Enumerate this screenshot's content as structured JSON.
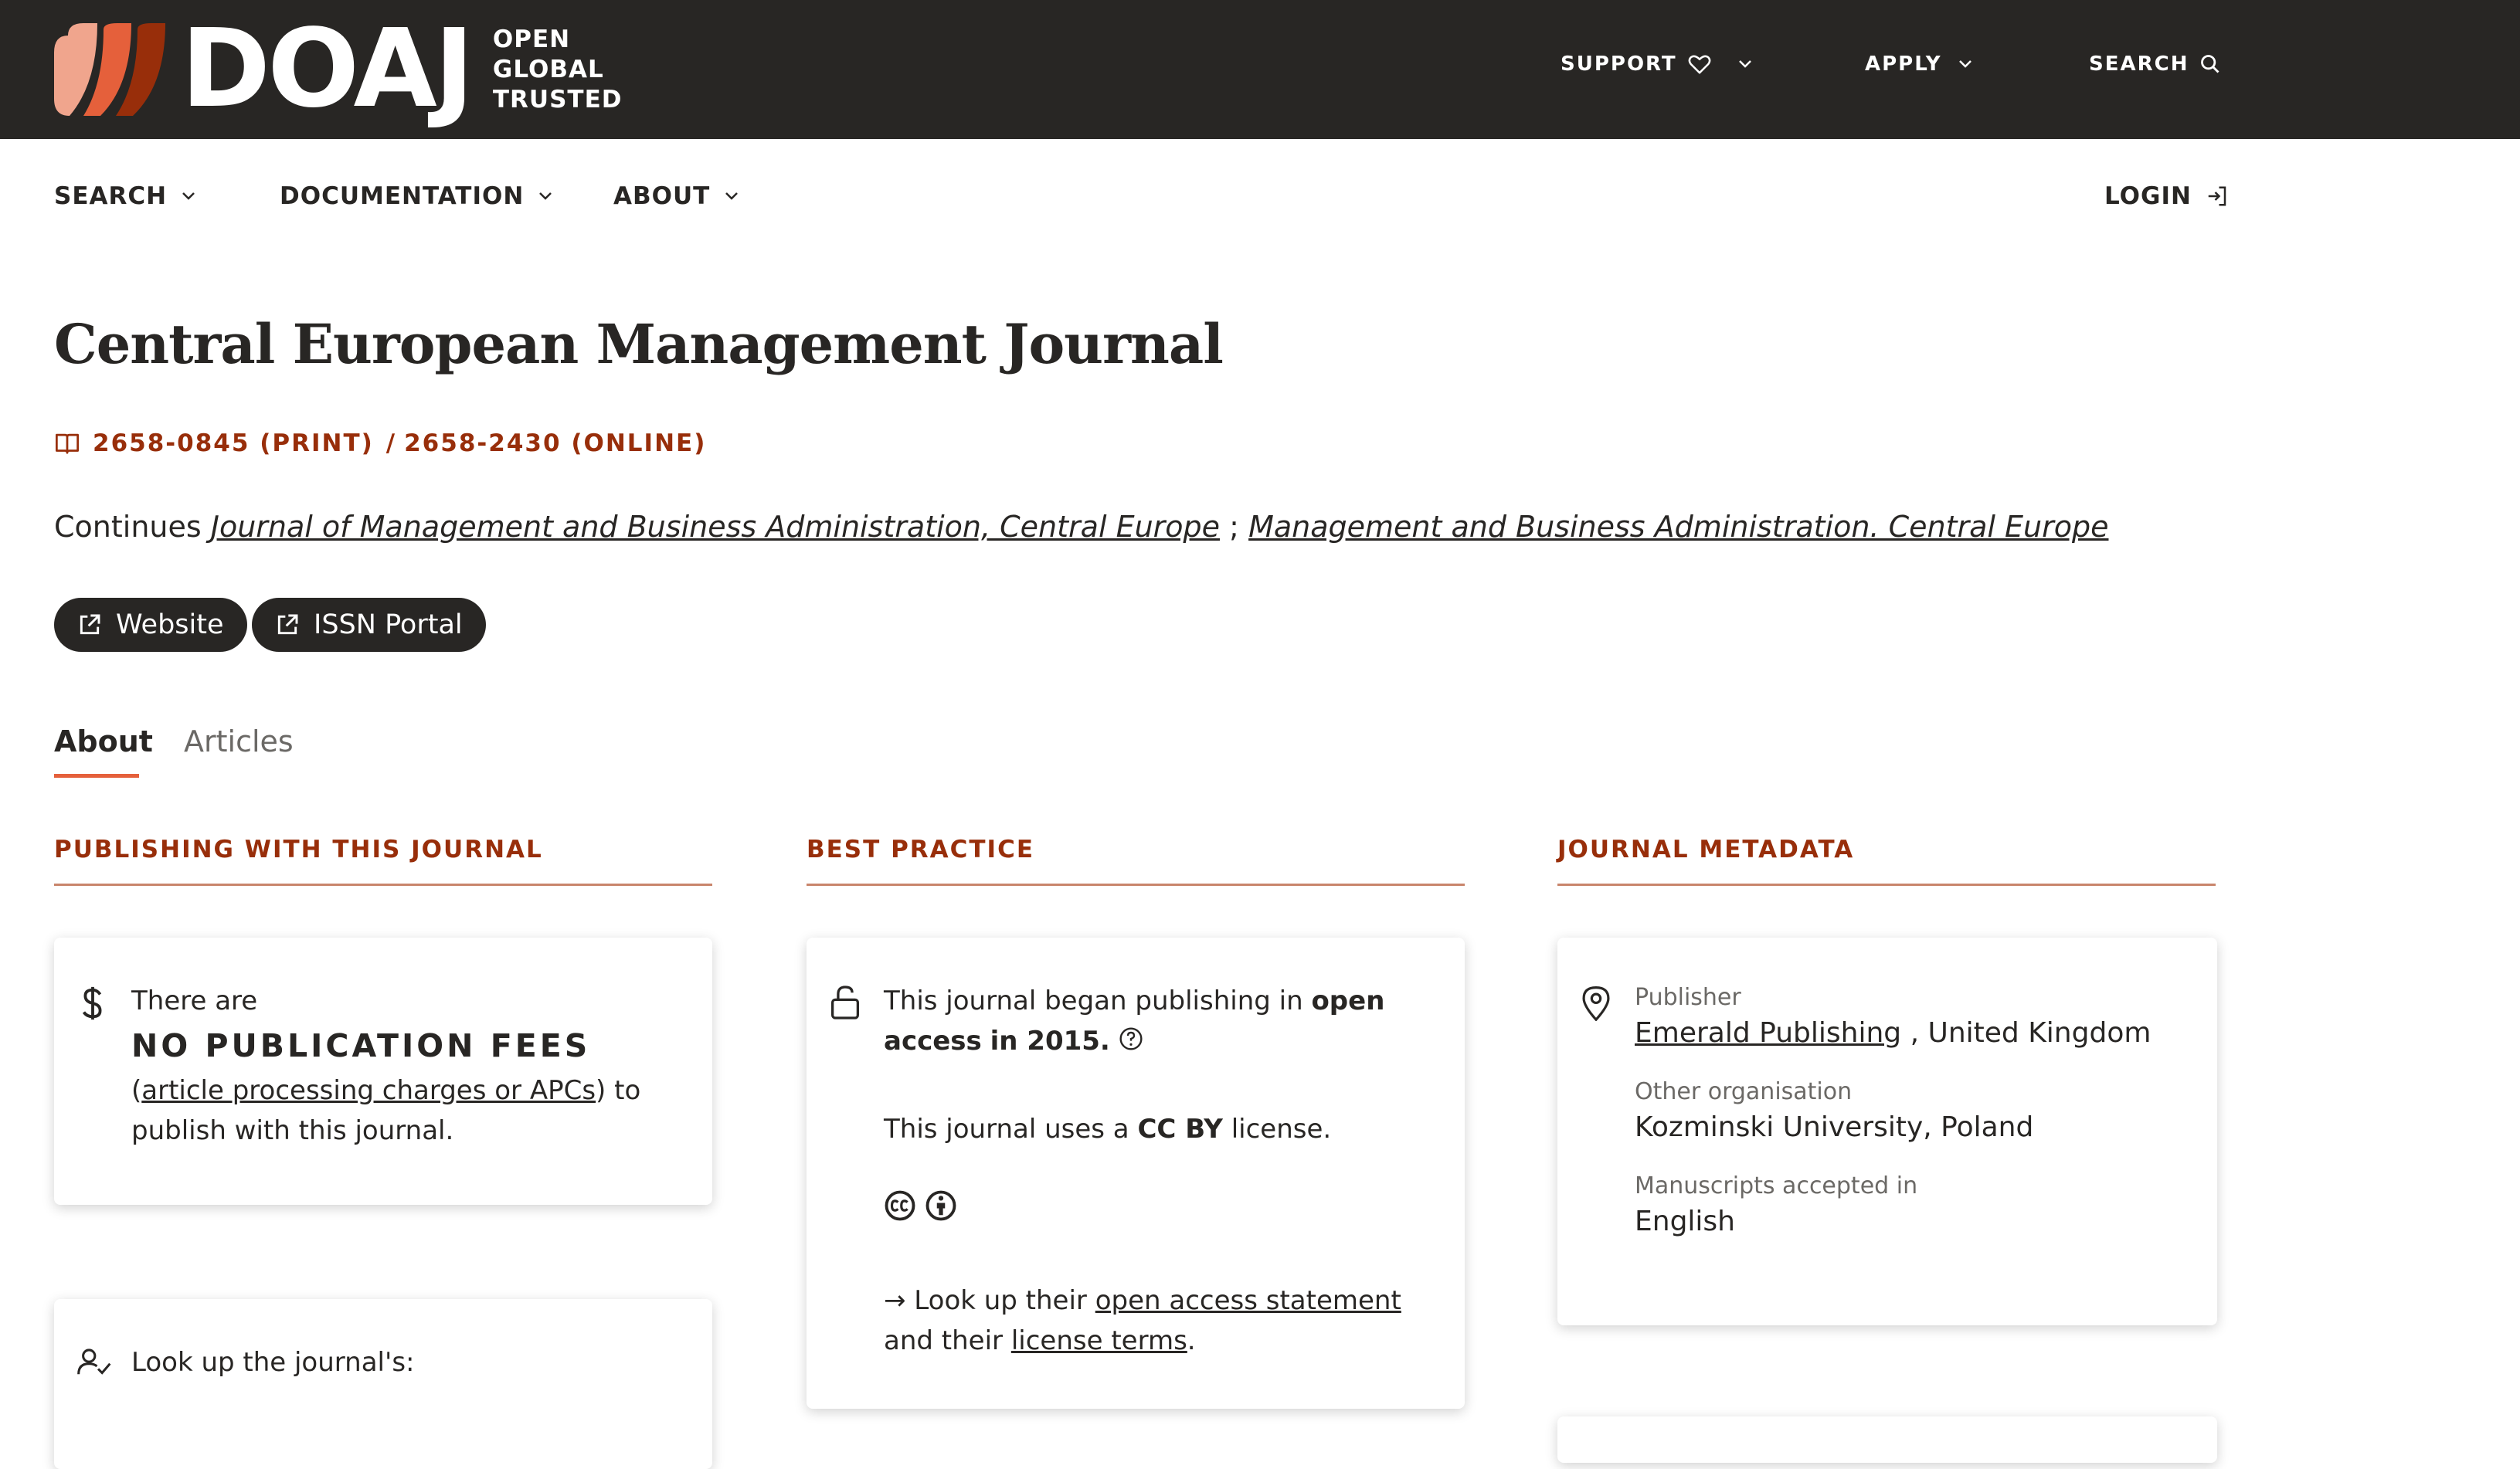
{
  "header": {
    "logo_text": "DOAJ",
    "tagline": [
      "OPEN",
      "GLOBAL",
      "TRUSTED"
    ],
    "nav": [
      {
        "label": "SUPPORT",
        "icon": "heart-icon"
      },
      {
        "label": "APPLY",
        "icon": "chevron-down-icon"
      },
      {
        "label": "SEARCH",
        "icon": "search-icon"
      }
    ],
    "colors": {
      "background": "#282624",
      "logo_left": "#f0a58d",
      "logo_mid": "#e5603b",
      "logo_right": "#982e0a"
    }
  },
  "subnav": {
    "items": [
      "SEARCH",
      "DOCUMENTATION",
      "ABOUT"
    ],
    "login": "LOGIN"
  },
  "journal": {
    "title": "Central European Management Journal",
    "issn_print": "2658-0845 (PRINT)",
    "issn_separator": "/",
    "issn_online": "2658-2430 (ONLINE)",
    "continues_prefix": "Continues",
    "continues_1": "Journal of Management and Business Administration, Central Europe",
    "continues_sep": ";",
    "continues_2": "Management and Business Administration. Central Europe",
    "buttons": {
      "website": "Website",
      "issn_portal": "ISSN Portal"
    }
  },
  "tabs": [
    {
      "label": "About",
      "active": true
    },
    {
      "label": "Articles",
      "active": false
    }
  ],
  "sections": {
    "publishing": {
      "heading": "PUBLISHING WITH THIS JOURNAL",
      "fees_intro": "There are",
      "fees_main": "NO PUBLICATION FEES",
      "fees_link": "article processing charges or APCs",
      "fees_open_paren": "(",
      "fees_close": ") to",
      "fees_tail": "publish with this journal.",
      "lookup": "Look up the journal's:"
    },
    "best_practice": {
      "heading": "BEST PRACTICE",
      "oa_prefix": "This journal began publishing in",
      "oa_bold": "open access",
      "oa_year": "in 2015.",
      "license_prefix": "This journal uses a",
      "license_bold": "CC BY",
      "license_suffix": "license.",
      "lookup_prefix": "→ Look up their",
      "lookup_link1": "open access statement",
      "lookup_and": "and",
      "lookup_their": "their",
      "lookup_link2": "license terms",
      "lookup_end": "."
    },
    "metadata": {
      "heading": "JOURNAL METADATA",
      "publisher_label": "Publisher",
      "publisher_link": "Emerald Publishing",
      "publisher_country": ", United Kingdom",
      "other_org_label": "Other organisation",
      "other_org_value": "Kozminski University, Poland",
      "manuscripts_label": "Manuscripts accepted in",
      "manuscripts_value": "English"
    }
  }
}
